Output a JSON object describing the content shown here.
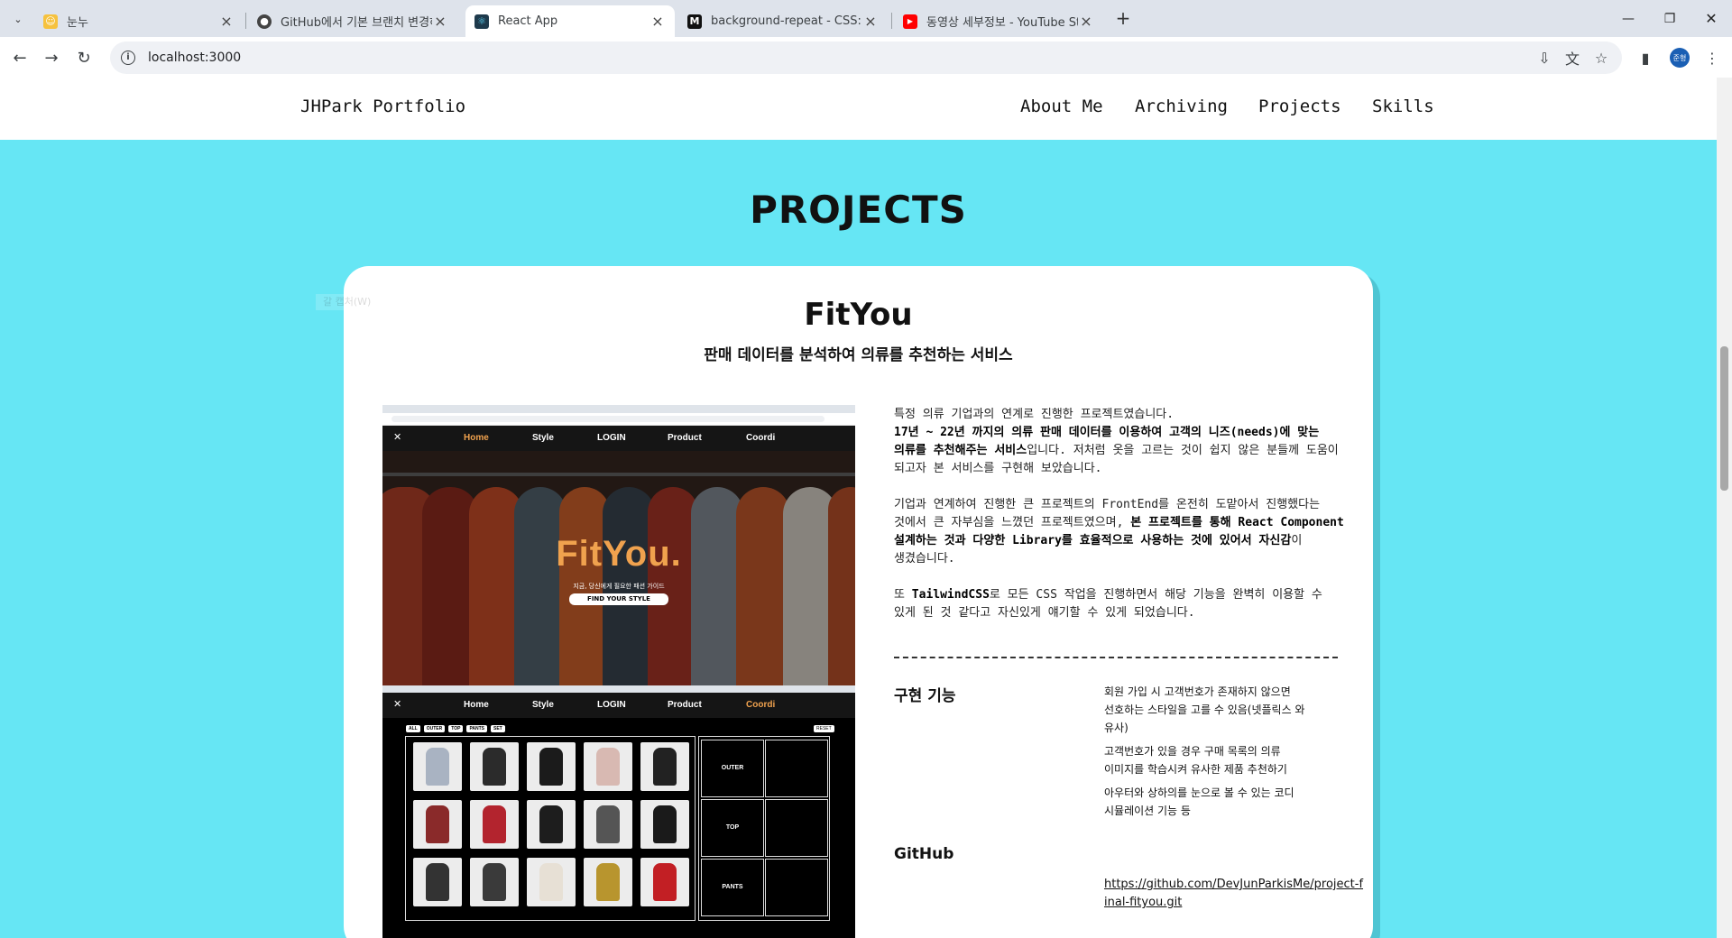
{
  "browser": {
    "tabs": [
      {
        "title": "눈누",
        "icon": "character-favicon-icon",
        "active": false
      },
      {
        "title": "GitHub에서 기본 브랜치 변경하",
        "icon": "github-favicon-icon",
        "active": false
      },
      {
        "title": "React App",
        "icon": "react-favicon-icon",
        "active": true
      },
      {
        "title": "background-repeat - CSS: Cas",
        "icon": "mdn-favicon-icon",
        "active": false
      },
      {
        "title": "동영상 세부정보 - YouTube Stu",
        "icon": "youtube-favicon-icon",
        "active": false
      }
    ],
    "url": "localhost:3000",
    "profile_initial": "준형"
  },
  "site": {
    "brand": "JHPark Portfolio",
    "menu": [
      "About Me",
      "Archiving",
      "Projects",
      "Skills"
    ],
    "section_title": "PROJECTS",
    "ghost_text": "갈 캡처(W)"
  },
  "project": {
    "title": "FitYou",
    "subtitle": "판매 데이터를 분석하여 의류를 추천하는 서비스",
    "screenshot": {
      "nav": [
        "Home",
        "Style",
        "LOGIN",
        "Product",
        "Coordi"
      ],
      "hero_logo": "FitYou.",
      "hero_tagline": "지금, 당신에게 필요한 패션 가이드",
      "hero_cta": "FIND YOUR STYLE",
      "filters": [
        "ALL",
        "OUTER",
        "TOP",
        "PANTS",
        "SET"
      ],
      "reset": "RESET",
      "slots": [
        "OUTER",
        "TOP",
        "PANTS"
      ],
      "accent_color": "#f0a24e"
    },
    "para1_a": "특정 의류 기업과의 연계로 진행한 프로젝트였습니다.",
    "para1_b": "17년 ~ 22년 까지의 의류 판매 데이터를 이용하여 고객의 니즈(needs)에 맞는 의류를 추천해주는 서비스",
    "para1_c": "입니다. 저처럼 옷을 고르는 것이 쉽지 않은 분들께 도움이 되고자 본 서비스를 구현해 보았습니다.",
    "para2_a": "기업과 연계하여 진행한 큰 프로젝트의 FrontEnd를 온전히 도맡아서 진행했다는 것에서 큰 자부심을 느꼈던 프로젝트였으며, ",
    "para2_b": "본 프로젝트를 통해 React Component 설계하는 것과 다양한 Library를 효율적으로 사용하는 것에 있어서 자신감",
    "para2_c": "이 생겼습니다.",
    "para3_a": "또 ",
    "para3_b": "TailwindCSS",
    "para3_c": "로 모든 CSS 작업을 진행하면서 해당 기능을 완벽히 이용할 수 있게 된 것 같다고 자신있게 얘기할 수 있게 되었습니다.",
    "features_heading": "구현 기능",
    "features": [
      "회원 가입 시 고객번호가 존재하지 않으면 선호하는 스타일을 고를 수 있음(넷플릭스 와 유사)",
      "고객번호가 있을 경우 구매 목록의 의류 이미지를 학습시켜 유사한 제품 추천하기",
      "아우터와 상하의를 눈으로 볼 수 있는 코디 시뮬레이션 기능 등"
    ],
    "github_heading": "GitHub",
    "github_url": "https://github.com/DevJunParkisMe/project-final-fityou.git"
  },
  "colors": {
    "page_bg": "#66e6f4",
    "card_shadow": "#4fc5d3"
  }
}
